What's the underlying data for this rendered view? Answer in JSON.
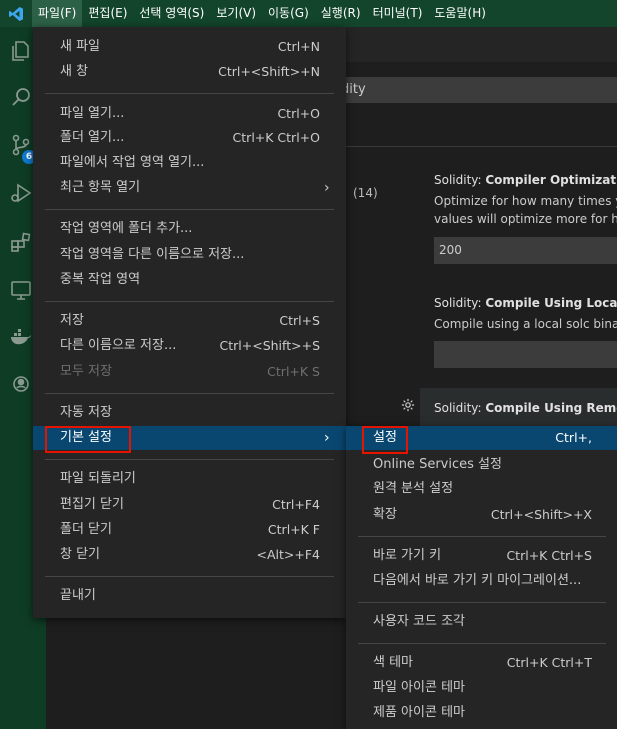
{
  "menubar": {
    "items": [
      "파일(F)",
      "편집(E)",
      "선택 영역(S)",
      "보기(V)",
      "이동(G)",
      "실행(R)",
      "터미널(T)",
      "도움말(H)"
    ]
  },
  "activity": {
    "scm_badge": "6"
  },
  "settings": {
    "search_value": "dity",
    "count": "(14)",
    "s1_prefix": "Solidity: ",
    "s1_title": "Compiler Optimization",
    "s1_desc1": "Optimize for how many times yo",
    "s1_desc2": "values will optimize more for hig",
    "s1_value": "200",
    "s2_prefix": "Solidity: ",
    "s2_title": "Compile Using Local V",
    "s2_desc": "Compile using a local solc binary",
    "s3_prefix": "Solidity: ",
    "s3_title": "Compile Using Remote"
  },
  "file_menu": {
    "new_file": "새 파일",
    "new_file_key": "Ctrl+N",
    "new_window": "새 창",
    "new_window_key": "Ctrl+<Shift>+N",
    "open_file": "파일 열기...",
    "open_file_key": "Ctrl+O",
    "open_folder": "폴더 열기...",
    "open_folder_key": "Ctrl+K Ctrl+O",
    "open_workspace": "파일에서 작업 영역 열기...",
    "open_recent": "최근 항목 열기",
    "add_folder": "작업 영역에 폴더 추가...",
    "save_workspace_as": "작업 영역을 다른 이름으로 저장...",
    "duplicate_workspace": "중복 작업 영역",
    "save": "저장",
    "save_key": "Ctrl+S",
    "save_as": "다른 이름으로 저장...",
    "save_as_key": "Ctrl+<Shift>+S",
    "save_all": "모두 저장",
    "save_all_key": "Ctrl+K S",
    "auto_save": "자동 저장",
    "preferences": "기본 설정",
    "revert_file": "파일 되돌리기",
    "close_editor": "편집기 닫기",
    "close_editor_key": "Ctrl+F4",
    "close_folder": "폴더 닫기",
    "close_folder_key": "Ctrl+K F",
    "close_window": "창 닫기",
    "close_window_key": "<Alt>+F4",
    "exit": "끝내기"
  },
  "pref_menu": {
    "settings": "설정",
    "settings_key": "Ctrl+,",
    "online_services": "Online Services 설정",
    "telemetry": "원격 분석 설정",
    "extensions": "확장",
    "extensions_key": "Ctrl+<Shift>+X",
    "keyboard_shortcuts": "바로 가기 키",
    "keyboard_shortcuts_key": "Ctrl+K Ctrl+S",
    "migrate_keymaps": "다음에서 바로 가기 키 마이그레이션...",
    "user_snippets": "사용자 코드 조각",
    "color_theme": "색 테마",
    "color_theme_key": "Ctrl+K Ctrl+T",
    "file_icon_theme": "파일 아이콘 테마",
    "product_icon_theme": "제품 아이콘 테마"
  }
}
